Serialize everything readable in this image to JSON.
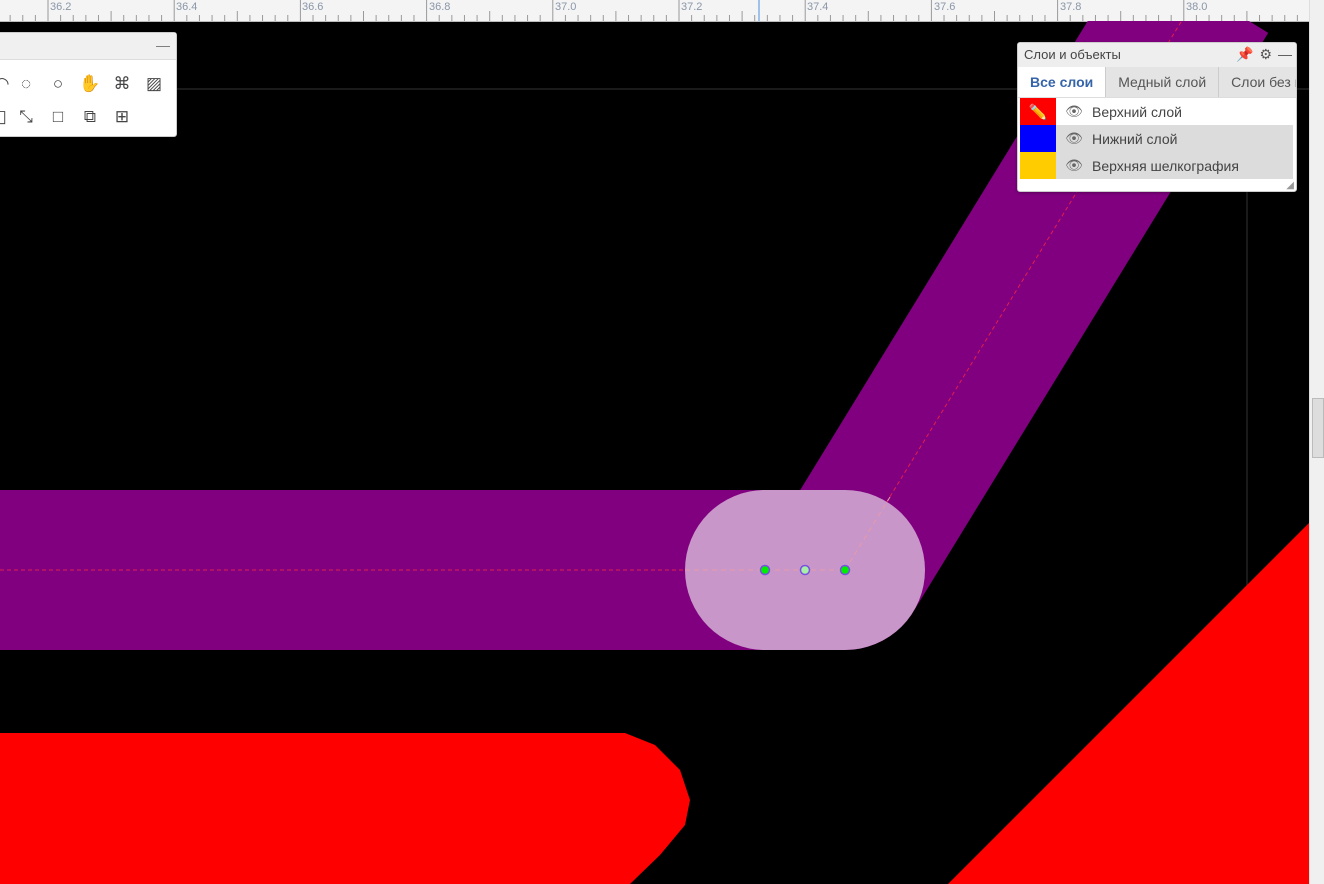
{
  "ruler": {
    "labels": [
      "36.2",
      "36.4",
      "36.6",
      "36.8",
      "37.0",
      "37.2",
      "37.4",
      "37.6",
      "37.8",
      "38.0"
    ]
  },
  "tools": {
    "minimize": "—",
    "row1": [
      "arc-tool",
      "arc-center-tool",
      "circle-tool",
      "pan-tool",
      "fit-tool",
      "image-tool"
    ],
    "row2": [
      "rect-tool",
      "measure-tool",
      "square-tool",
      "group-tool",
      "table-tool"
    ]
  },
  "layers_panel": {
    "title": "Слои и объекты",
    "minimize": "—",
    "tabs": [
      {
        "label": "Все слои",
        "active": true
      },
      {
        "label": "Медный слой"
      },
      {
        "label": "Слои без м"
      }
    ],
    "layers": [
      {
        "name": "Верхний слой",
        "color": "#ff0000",
        "active": true
      },
      {
        "name": "Нижний слой",
        "color": "#0000ff"
      },
      {
        "name": "Верхняя шелкография",
        "color": "#ffcc00"
      }
    ]
  },
  "colors": {
    "track": "#800080",
    "pad": "#c896c8",
    "copper_top": "#ff0000",
    "node": "#00ee00"
  }
}
